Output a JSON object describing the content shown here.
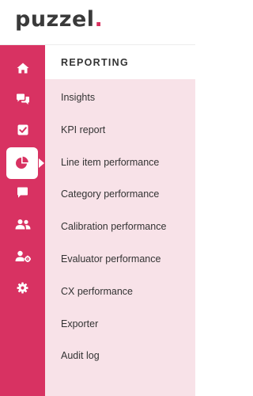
{
  "brand": {
    "name_prefix": "puzzel",
    "name_suffix": ".",
    "accent_color": "#d83262",
    "panel_color": "#f8e2e8"
  },
  "rail": {
    "items": [
      {
        "icon": "home-icon",
        "active": false
      },
      {
        "icon": "chat-bubbles-icon",
        "active": false
      },
      {
        "icon": "checkbox-icon",
        "active": false
      },
      {
        "icon": "pie-chart-icon",
        "active": true
      },
      {
        "icon": "message-icon",
        "active": false
      },
      {
        "icon": "users-icon",
        "active": false
      },
      {
        "icon": "user-settings-icon",
        "active": false
      },
      {
        "icon": "gear-icon",
        "active": false
      }
    ]
  },
  "panel": {
    "title": "REPORTING",
    "items": [
      {
        "label": "Insights"
      },
      {
        "label": "KPI report"
      },
      {
        "label": "Line item performance"
      },
      {
        "label": "Category performance"
      },
      {
        "label": "Calibration performance"
      },
      {
        "label": "Evaluator performance"
      },
      {
        "label": "CX performance"
      },
      {
        "label": "Exporter"
      },
      {
        "label": "Audit log"
      }
    ]
  }
}
